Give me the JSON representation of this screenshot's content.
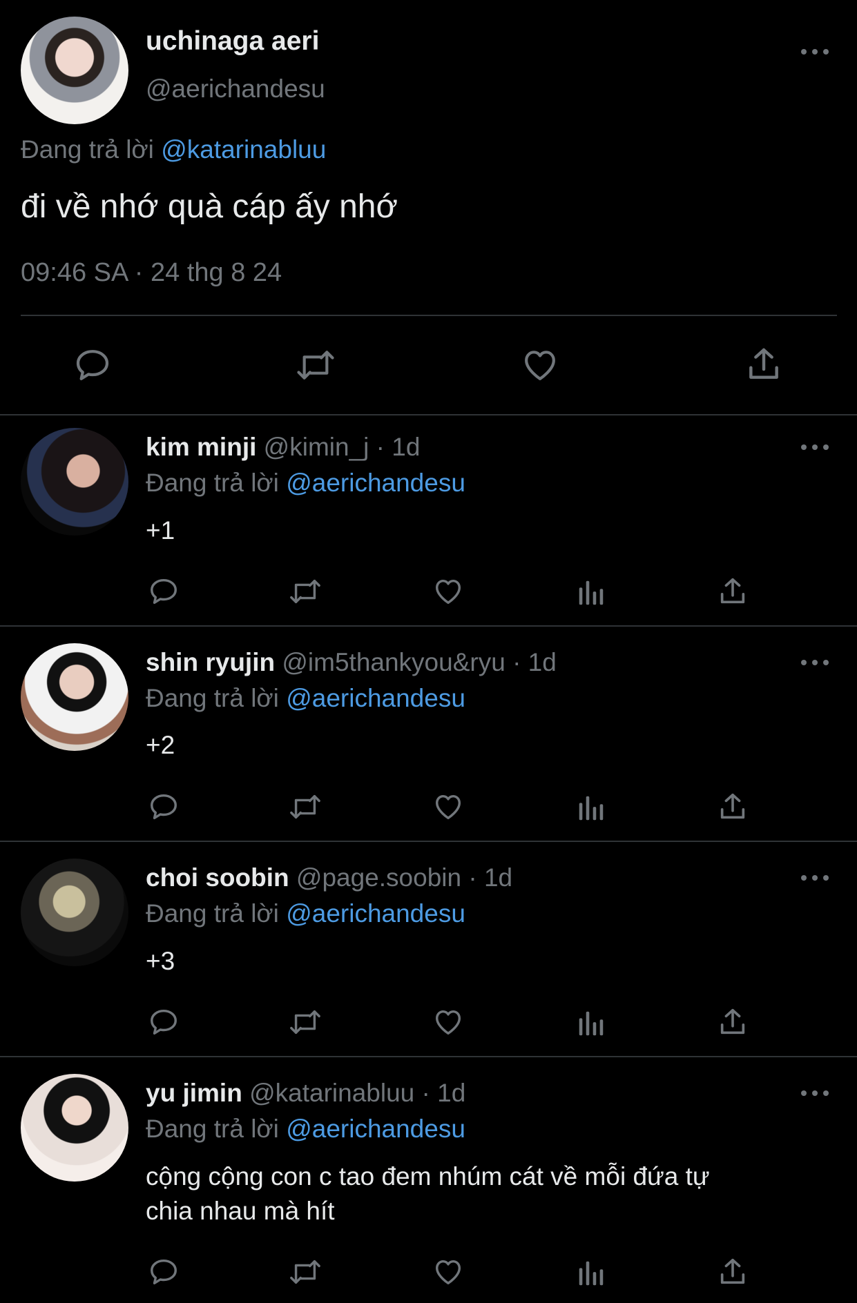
{
  "main_tweet": {
    "display_name": "uchinaga aeri",
    "handle": "@aerichandesu",
    "replying_prefix": "Đang trả lời",
    "replying_to": "@katarinabluu",
    "text": "đi về nhớ quà cáp ấy nhớ",
    "timestamp": "09:46 SA · 24 thg 8 24"
  },
  "replies": [
    {
      "display_name": "kim minji",
      "handle": "@kimin_j",
      "age": "· 1d",
      "replying_prefix": "Đang trả lời",
      "replying_to": "@aerichandesu",
      "text": "+1"
    },
    {
      "display_name": "shin ryujin",
      "handle": "@im5thankyou&ryu",
      "age": "· 1d",
      "replying_prefix": "Đang trả lời",
      "replying_to": "@aerichandesu",
      "text": "+2"
    },
    {
      "display_name": "choi soobin",
      "handle": "@page.soobin",
      "age": "· 1d",
      "replying_prefix": "Đang trả lời",
      "replying_to": "@aerichandesu",
      "text": "+3"
    },
    {
      "display_name": "yu jimin",
      "handle": "@katarinabluu",
      "age": "· 1d",
      "replying_prefix": "Đang trả lời",
      "replying_to": "@aerichandesu",
      "text_line1": "cộng cộng con c tao đem nhúm cát về mỗi đứa tự",
      "text_line2": "chia nhau mà hít"
    }
  ],
  "icons": [
    "reply-icon",
    "retweet-icon",
    "like-icon",
    "share-icon",
    "views-icon",
    "more-icon"
  ],
  "colors": {
    "background": "#000000",
    "text": "#e7e9ea",
    "muted": "#71767b",
    "link": "#4d9be3",
    "divider": "#2f3336"
  }
}
